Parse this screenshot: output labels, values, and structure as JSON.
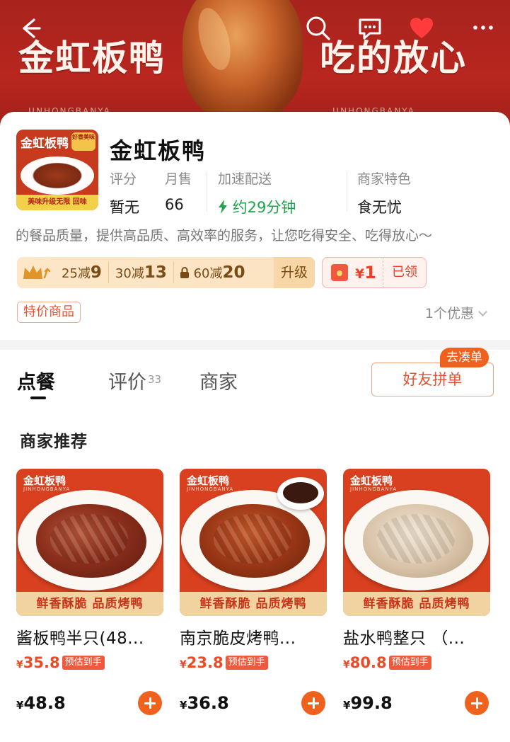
{
  "banner": {
    "left_text": "金虹板鸭",
    "right_text": "吃的放心",
    "script_text_left": "JINHONGBANYA",
    "script_text_right": "JINHONGBANYA"
  },
  "store": {
    "name": "金虹板鸭",
    "logo": {
      "title": "金虹板鸭",
      "badge": "好香美味",
      "bottom": "美味升级无限 回味"
    },
    "stats": [
      {
        "label": "评分",
        "value": "暂无"
      },
      {
        "label": "月售",
        "value": "66"
      },
      {
        "label": "加速配送",
        "value": "约29分钟"
      },
      {
        "label": "商家特色",
        "value": "食无忧"
      }
    ],
    "slogan": "的餐品质量，提供高品质、高效率的服务，让您吃得安全、吃得放心～",
    "coupons": [
      {
        "prefix": "25减",
        "amount": "9"
      },
      {
        "prefix": "30减",
        "amount": "13"
      },
      {
        "prefix": "60减",
        "amount": "20"
      }
    ],
    "upgrade_label": "升级",
    "red_packet": {
      "currency": "¥",
      "amount": "1",
      "status": "已领"
    },
    "special_tag": "特价商品",
    "offers_label": "1个优惠"
  },
  "tabs": {
    "items": [
      {
        "label": "点餐"
      },
      {
        "label": "评价",
        "count": "33"
      },
      {
        "label": "商家"
      }
    ],
    "group_order_label": "好友拼单",
    "group_order_badge": "去凑单"
  },
  "section": {
    "title": "商家推荐"
  },
  "products": [
    {
      "name": "酱板鸭半只(48...",
      "price": "35.8",
      "price_tag": "预估到手",
      "original": "48.8",
      "img_brand": "金虹板鸭",
      "img_banner": "鲜香酥脆 品质烤鸭"
    },
    {
      "name": "南京脆皮烤鸭...",
      "price": "23.8",
      "price_tag": "预估到手",
      "original": "36.8",
      "img_brand": "金虹板鸭",
      "img_banner": "鲜香酥脆 品质烤鸭"
    },
    {
      "name": "盐水鸭整只 （...",
      "price": "80.8",
      "price_tag": "预估到手",
      "original": "99.8",
      "img_brand": "金虹板鸭",
      "img_banner": "鲜香酥脆 品质烤鸭"
    }
  ],
  "currency_symbol": "¥",
  "icons": [
    "back-arrow-icon",
    "search-icon",
    "message-icon",
    "heart-icon",
    "more-icon",
    "lightning-icon",
    "crown-icon",
    "lock-icon",
    "red-packet-icon",
    "chevron-down-icon",
    "add-icon"
  ],
  "colors": {
    "brand_red": "#b8261f",
    "accent_orange": "#f0611d",
    "price_red": "#ec4a26",
    "delivery_green": "#1ea34a"
  }
}
